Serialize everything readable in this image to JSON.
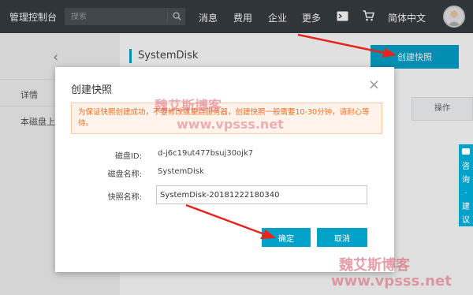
{
  "topbar": {
    "brand": "管理控制台",
    "search_placeholder": "搜索",
    "nav": [
      "消息",
      "费用",
      "企业",
      "更多"
    ],
    "language": "简体中文"
  },
  "sidebar": {
    "back_glyph": "‹",
    "items": [
      "详情",
      "本磁盘上的快照"
    ]
  },
  "main": {
    "disk_title": "SystemDisk",
    "create_snapshot_label": "创建快照",
    "table_header_ops": "操作"
  },
  "modal": {
    "title": "创建快照",
    "close_glyph": "×",
    "notice": "为保证快照创建成功，不要修改或重启服务器，创建快照一般需要10-30分钟，请耐心等待。",
    "fields": {
      "disk_id_label": "磁盘ID:",
      "disk_id_value": "d-j6c19ut477bsuj30ojk7",
      "disk_name_label": "磁盘名称:",
      "disk_name_value": "SystemDisk",
      "snapshot_name_label": "快照名称:",
      "snapshot_name_value": "SystemDisk-20181222180340"
    },
    "ok_label": "确定",
    "cancel_label": "取消"
  },
  "sidetab": {
    "label": "咨询·建议"
  },
  "watermark": {
    "cn": "魏艾斯博客",
    "url": "www.vpsss.net"
  },
  "colors": {
    "topbar": "#373d41",
    "accent": "#00a2ca",
    "notice_text": "#f37021",
    "notice_bg": "#fff3eb",
    "arrow": "#e8231d"
  },
  "icons": [
    "search-icon",
    "terminal-icon",
    "cart-icon",
    "avatar",
    "chevron-left-icon",
    "close-icon",
    "chat-icon"
  ]
}
